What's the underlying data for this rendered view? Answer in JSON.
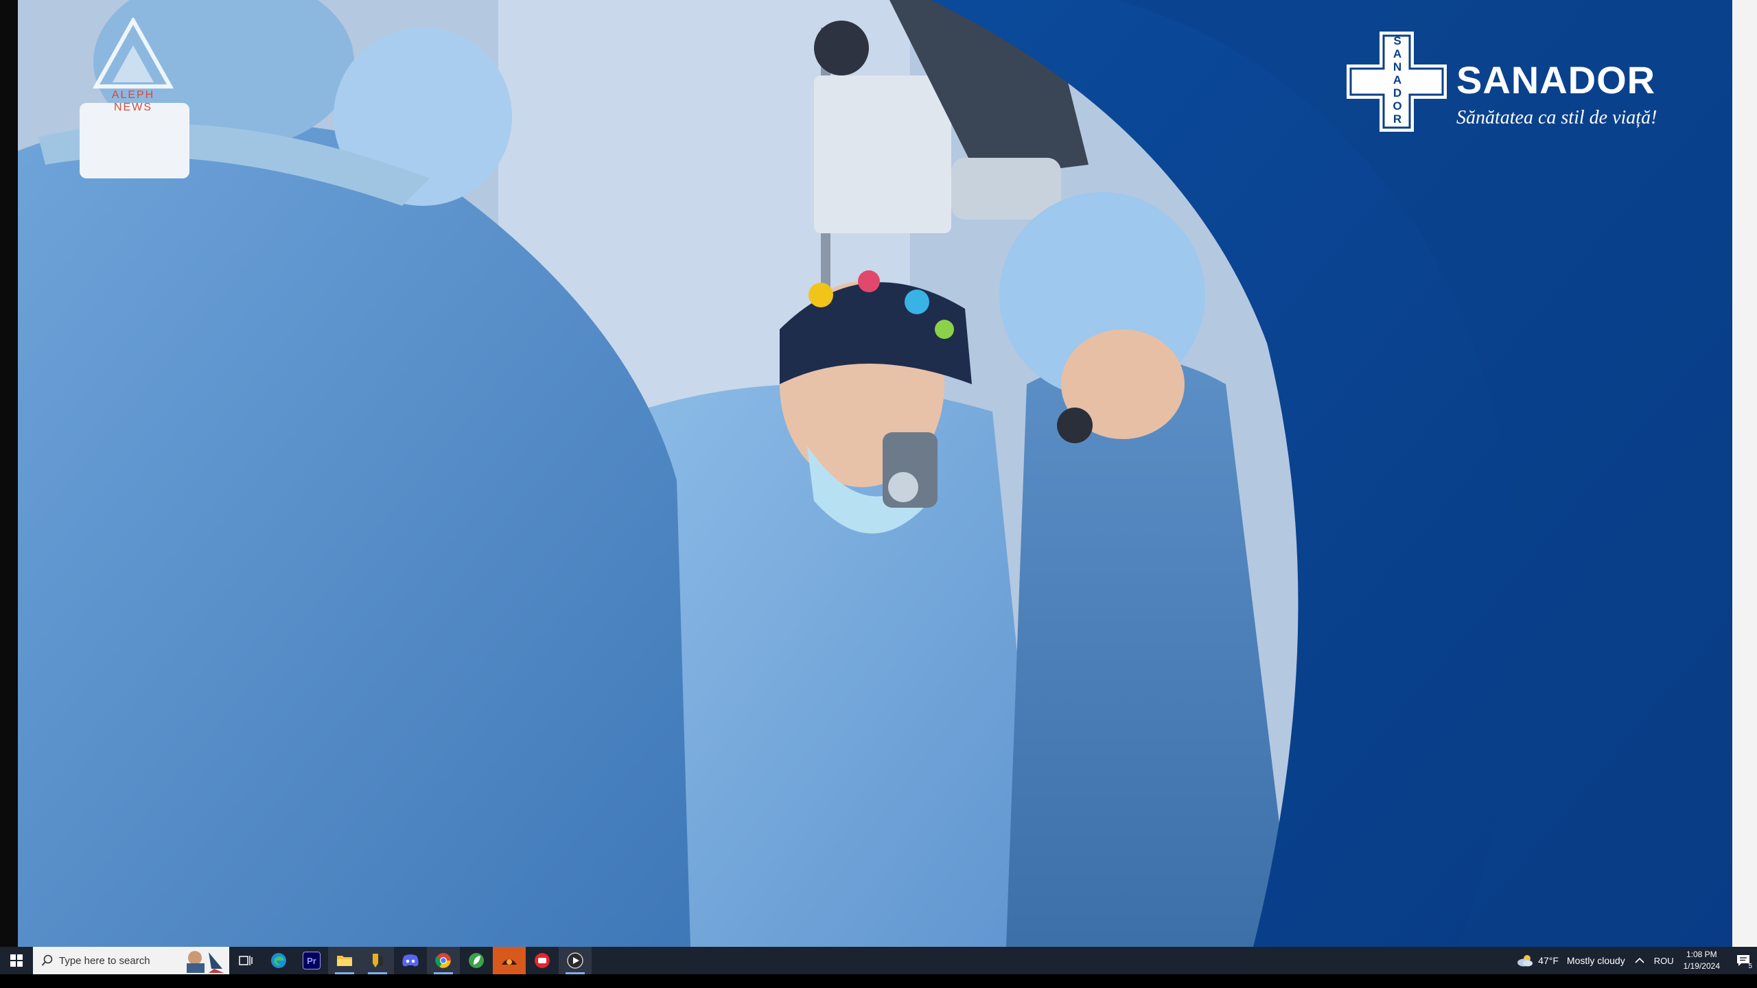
{
  "watermark": {
    "text": "ALEPH NEWS"
  },
  "brand": {
    "name": "SANADOR",
    "tagline": "Sănătatea ca stil de viață!",
    "cross_letters": [
      "S",
      "A",
      "N",
      "A",
      "D",
      "O",
      "R"
    ],
    "color_primary": "#0a3f8a",
    "color_panel": "#0b4290"
  },
  "taskbar": {
    "search_placeholder": "Type here to search",
    "apps": [
      {
        "name": "task-view",
        "icon": "task-view-icon"
      },
      {
        "name": "edge",
        "icon": "edge-icon"
      },
      {
        "name": "premiere-pro",
        "icon": "premiere-icon",
        "label": "Pr"
      },
      {
        "name": "file-explorer",
        "icon": "folder-icon"
      },
      {
        "name": "app-yellow",
        "icon": "pen-icon"
      },
      {
        "name": "discord",
        "icon": "discord-icon"
      },
      {
        "name": "chrome",
        "icon": "chrome-icon"
      },
      {
        "name": "app-green",
        "icon": "leaf-icon"
      },
      {
        "name": "app-orange",
        "icon": "video-app-icon"
      },
      {
        "name": "app-red",
        "icon": "chat-icon"
      },
      {
        "name": "media-player",
        "icon": "play-icon"
      }
    ]
  },
  "tray": {
    "weather_temp": "47°F",
    "weather_desc": "Mostly cloudy",
    "language": "ROU",
    "time": "1:08 PM",
    "date": "1/19/2024",
    "notifications": "5"
  }
}
